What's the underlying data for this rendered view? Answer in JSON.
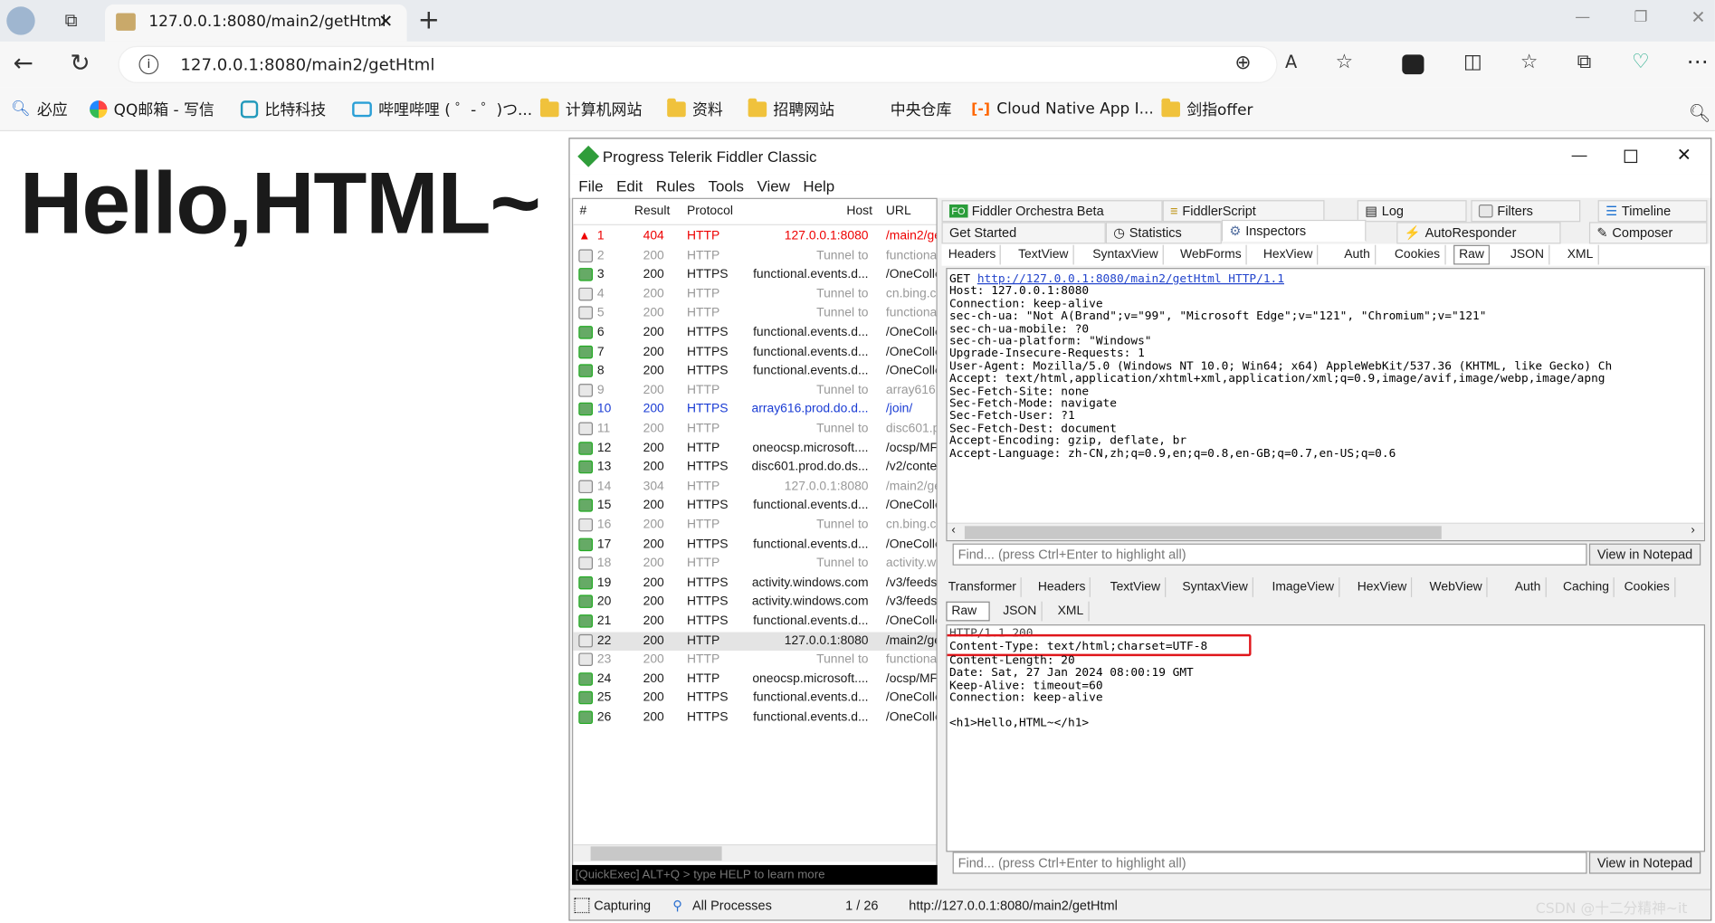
{
  "browser": {
    "tab_title": "127.0.0.1:8080/main2/getHtml",
    "address": "127.0.0.1:8080/main2/getHtml",
    "bookmarks": [
      {
        "label": "必应",
        "icon": "search-icon"
      },
      {
        "label": "QQ邮箱 - 写信",
        "icon": "qq-mail-icon"
      },
      {
        "label": "比特科技",
        "icon": "bit-icon"
      },
      {
        "label": "哔哩哔哩 ( ゜- ゜)つ...",
        "icon": "bilibili-icon"
      },
      {
        "label": "计算机网站",
        "icon": "folder-icon"
      },
      {
        "label": "资料",
        "icon": "folder-icon"
      },
      {
        "label": "招聘网站",
        "icon": "folder-icon"
      },
      {
        "label": "中央仓库",
        "icon": "none"
      },
      {
        "label": "Cloud Native App I...",
        "icon": "cloud-native-icon"
      },
      {
        "label": "剑指offer",
        "icon": "folder-icon"
      }
    ]
  },
  "page": {
    "heading": "Hello,HTML~"
  },
  "fiddler": {
    "title": "Progress Telerik Fiddler Classic",
    "menu": [
      "File",
      "Edit",
      "Rules",
      "Tools",
      "View",
      "Help"
    ],
    "columns": [
      "#",
      "Result",
      "Protocol",
      "Host",
      "URL"
    ],
    "sessions": [
      {
        "id": "1",
        "result": "404",
        "protocol": "HTTP",
        "host": "127.0.0.1:8080",
        "url": "/main2/ge",
        "style": "red"
      },
      {
        "id": "2",
        "result": "200",
        "protocol": "HTTP",
        "host": "Tunnel to",
        "url": "functional",
        "style": "gray"
      },
      {
        "id": "3",
        "result": "200",
        "protocol": "HTTPS",
        "host": "functional.events.d...",
        "url": "/OneColle",
        "style": "normal"
      },
      {
        "id": "4",
        "result": "200",
        "protocol": "HTTP",
        "host": "Tunnel to",
        "url": "cn.bing.c",
        "style": "gray"
      },
      {
        "id": "5",
        "result": "200",
        "protocol": "HTTP",
        "host": "Tunnel to",
        "url": "functional",
        "style": "gray"
      },
      {
        "id": "6",
        "result": "200",
        "protocol": "HTTPS",
        "host": "functional.events.d...",
        "url": "/OneColle",
        "style": "normal"
      },
      {
        "id": "7",
        "result": "200",
        "protocol": "HTTPS",
        "host": "functional.events.d...",
        "url": "/OneColle",
        "style": "normal"
      },
      {
        "id": "8",
        "result": "200",
        "protocol": "HTTPS",
        "host": "functional.events.d...",
        "url": "/OneColle",
        "style": "normal"
      },
      {
        "id": "9",
        "result": "200",
        "protocol": "HTTP",
        "host": "Tunnel to",
        "url": "array616.",
        "style": "gray"
      },
      {
        "id": "10",
        "result": "200",
        "protocol": "HTTPS",
        "host": "array616.prod.do.d...",
        "url": "/join/",
        "style": "blue"
      },
      {
        "id": "11",
        "result": "200",
        "protocol": "HTTP",
        "host": "Tunnel to",
        "url": "disc601.p",
        "style": "gray"
      },
      {
        "id": "12",
        "result": "200",
        "protocol": "HTTP",
        "host": "oneocsp.microsoft....",
        "url": "/ocsp/MF",
        "style": "normal"
      },
      {
        "id": "13",
        "result": "200",
        "protocol": "HTTPS",
        "host": "disc601.prod.do.ds...",
        "url": "/v2/conte",
        "style": "normal"
      },
      {
        "id": "14",
        "result": "304",
        "protocol": "HTTP",
        "host": "127.0.0.1:8080",
        "url": "/main2/ge",
        "style": "gray"
      },
      {
        "id": "15",
        "result": "200",
        "protocol": "HTTPS",
        "host": "functional.events.d...",
        "url": "/OneColle",
        "style": "normal"
      },
      {
        "id": "16",
        "result": "200",
        "protocol": "HTTP",
        "host": "Tunnel to",
        "url": "cn.bing.c",
        "style": "gray"
      },
      {
        "id": "17",
        "result": "200",
        "protocol": "HTTPS",
        "host": "functional.events.d...",
        "url": "/OneColle",
        "style": "normal"
      },
      {
        "id": "18",
        "result": "200",
        "protocol": "HTTP",
        "host": "Tunnel to",
        "url": "activity.w",
        "style": "gray"
      },
      {
        "id": "19",
        "result": "200",
        "protocol": "HTTPS",
        "host": "activity.windows.com",
        "url": "/v3/feeds",
        "style": "normal"
      },
      {
        "id": "20",
        "result": "200",
        "protocol": "HTTPS",
        "host": "activity.windows.com",
        "url": "/v3/feeds",
        "style": "normal"
      },
      {
        "id": "21",
        "result": "200",
        "protocol": "HTTPS",
        "host": "functional.events.d...",
        "url": "/OneColle",
        "style": "normal"
      },
      {
        "id": "22",
        "result": "200",
        "protocol": "HTTP",
        "host": "127.0.0.1:8080",
        "url": "/main2/ge",
        "style": "selected"
      },
      {
        "id": "23",
        "result": "200",
        "protocol": "HTTP",
        "host": "Tunnel to",
        "url": "functional",
        "style": "gray"
      },
      {
        "id": "24",
        "result": "200",
        "protocol": "HTTP",
        "host": "oneocsp.microsoft....",
        "url": "/ocsp/MF",
        "style": "normal"
      },
      {
        "id": "25",
        "result": "200",
        "protocol": "HTTPS",
        "host": "functional.events.d...",
        "url": "/OneColle",
        "style": "normal"
      },
      {
        "id": "26",
        "result": "200",
        "protocol": "HTTPS",
        "host": "functional.events.d...",
        "url": "/OneColle",
        "style": "normal"
      }
    ],
    "quickexec": "[QuickExec] ALT+Q > type HELP to learn more",
    "status": {
      "capturing": "Capturing",
      "processes": "All Processes",
      "count": "1 / 26",
      "url": "http://127.0.0.1:8080/main2/getHtml"
    },
    "top_tabs_row1": [
      "Fiddler Orchestra Beta",
      "FiddlerScript",
      "Log",
      "Filters",
      "Timeline"
    ],
    "top_tabs_row2": [
      "Get Started",
      "Statistics",
      "Inspectors",
      "AutoResponder",
      "Composer"
    ],
    "request_tabs": [
      "Headers",
      "TextView",
      "SyntaxView",
      "WebForms",
      "HexView",
      "Auth",
      "Cookies",
      "Raw",
      "JSON",
      "XML"
    ],
    "request_link": "http://127.0.0.1:8080/main2/getHtml HTTP/1.1",
    "request_lines": [
      "Host: 127.0.0.1:8080",
      "Connection: keep-alive",
      "sec-ch-ua: \"Not A(Brand\";v=\"99\", \"Microsoft Edge\";v=\"121\", \"Chromium\";v=\"121\"",
      "sec-ch-ua-mobile: ?0",
      "sec-ch-ua-platform: \"Windows\"",
      "Upgrade-Insecure-Requests: 1",
      "User-Agent: Mozilla/5.0 (Windows NT 10.0; Win64; x64) AppleWebKit/537.36 (KHTML, like Gecko) Ch",
      "Accept: text/html,application/xhtml+xml,application/xml;q=0.9,image/avif,image/webp,image/apng",
      "Sec-Fetch-Site: none",
      "Sec-Fetch-Mode: navigate",
      "Sec-Fetch-User: ?1",
      "Sec-Fetch-Dest: document",
      "Accept-Encoding: gzip, deflate, br",
      "Accept-Language: zh-CN,zh;q=0.9,en;q=0.8,en-GB;q=0.7,en-US;q=0.6"
    ],
    "find_placeholder": "Find... (press Ctrl+Enter to highlight all)",
    "notepad_label": "View in Notepad",
    "response_tabs": [
      "Transformer",
      "Headers",
      "TextView",
      "SyntaxView",
      "ImageView",
      "HexView",
      "WebView",
      "Auth",
      "Caching",
      "Cookies"
    ],
    "response_subtabs": [
      "Raw",
      "JSON",
      "XML"
    ],
    "response_status": "HTTP/1.1 200",
    "response_content_type": "Content-Type: text/html;charset=UTF-8",
    "response_lines": [
      "Content-Length: 20",
      "Date: Sat, 27 Jan 2024 08:00:19 GMT",
      "Keep-Alive: timeout=60",
      "Connection: keep-alive"
    ],
    "response_body": "<h1>Hello,HTML~</h1>",
    "watermark": "CSDN @十二分精神~it"
  }
}
